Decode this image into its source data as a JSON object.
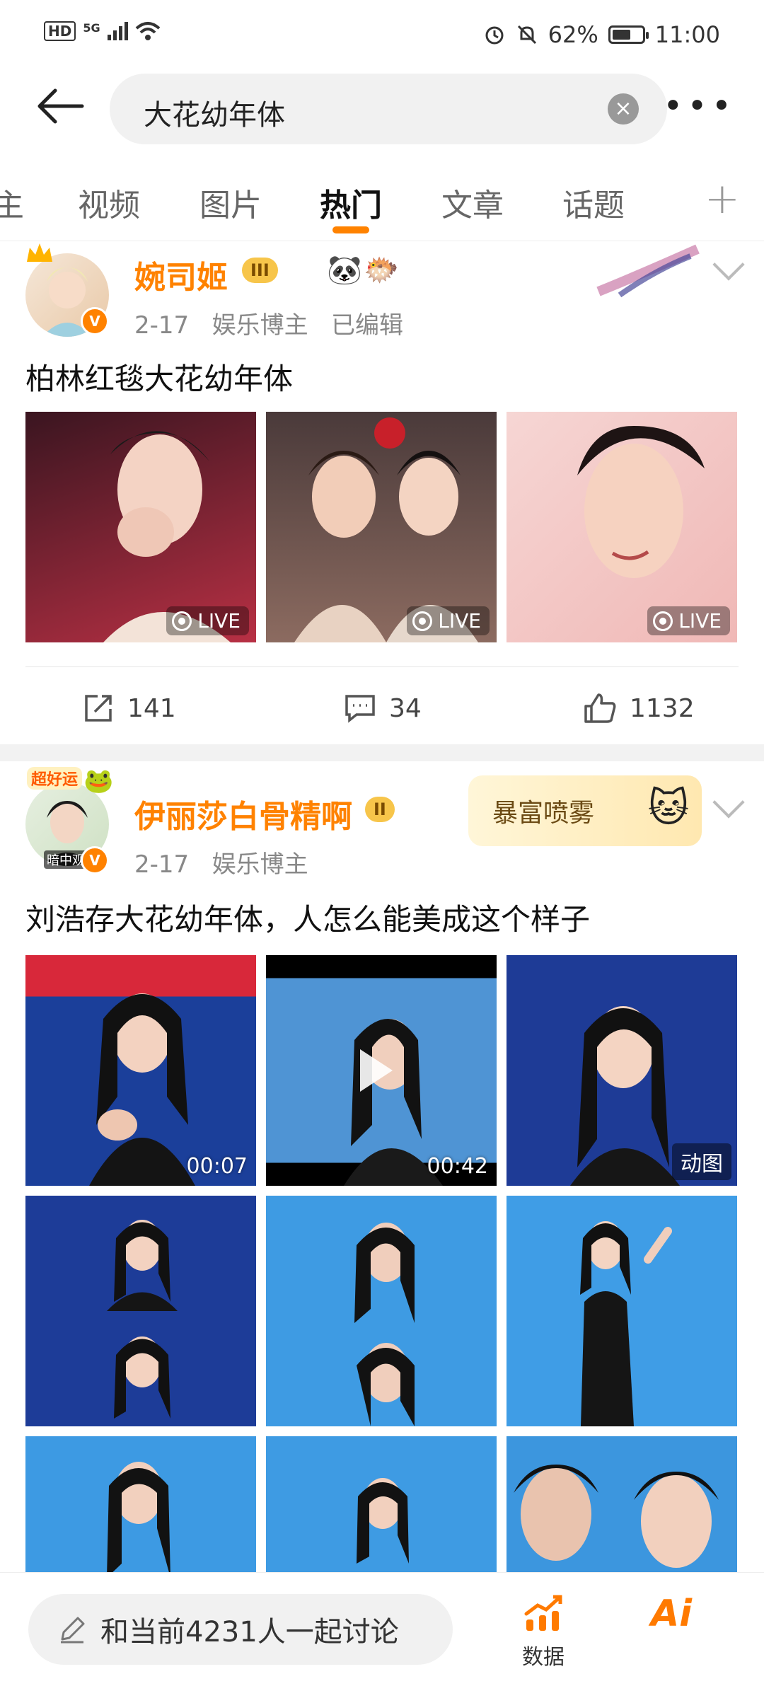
{
  "status_bar": {
    "hd": "HD",
    "network": "5G",
    "battery_text": "62%",
    "battery_level": 0.62,
    "time": "11:00"
  },
  "search": {
    "query": "大花幼年体"
  },
  "tabs": [
    {
      "label": "主",
      "active": false
    },
    {
      "label": "视频",
      "active": false
    },
    {
      "label": "图片",
      "active": false
    },
    {
      "label": "热门",
      "active": true
    },
    {
      "label": "文章",
      "active": false
    },
    {
      "label": "话题",
      "active": false
    }
  ],
  "posts": [
    {
      "username": "婉司姬",
      "level_badge": "III",
      "date": "2-17",
      "role": "娱乐博主",
      "edited": "已编辑",
      "text": "柏林红毯大花幼年体",
      "media_labels": [
        "LIVE",
        "LIVE",
        "LIVE"
      ],
      "actions": {
        "share": "141",
        "comment": "34",
        "like": "1132"
      }
    },
    {
      "username": "伊丽莎白骨精啊",
      "level_badge": "II",
      "avatar_caption": "暗中观",
      "avatar_tag": "超好运",
      "banner_text": "暴富喷雾",
      "date": "2-17",
      "role": "娱乐博主",
      "text": "刘浩存大花幼年体，人怎么能美成这个样子",
      "media_labels": [
        "00:07",
        "00:42",
        "动图"
      ]
    }
  ],
  "bottom": {
    "discuss_text": "和当前4231人一起讨论",
    "data_label": "数据",
    "ai_label": "Ai"
  },
  "colors": {
    "accent": "#ff8200",
    "background": "#ffffff"
  }
}
